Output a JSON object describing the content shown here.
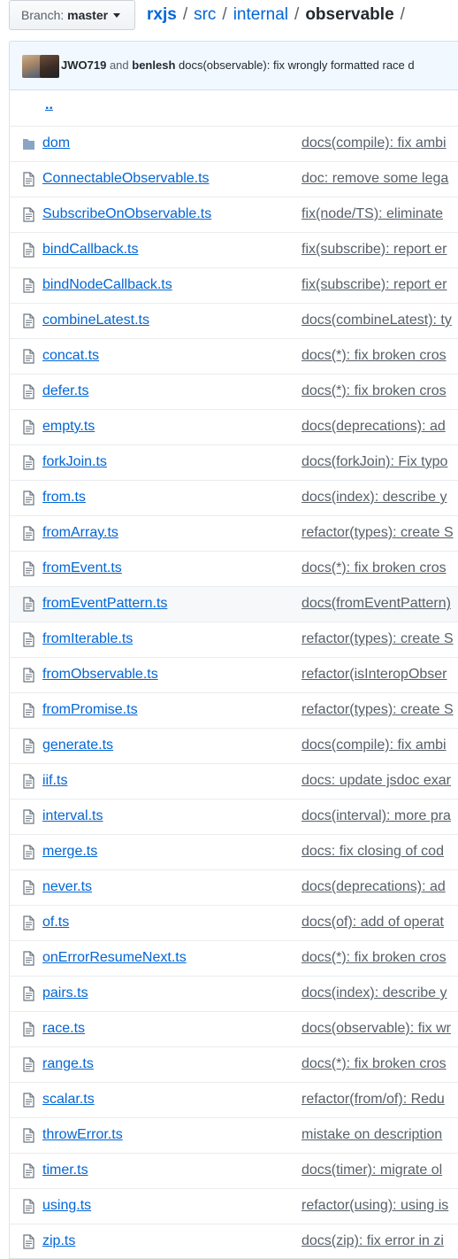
{
  "branch": {
    "label": "Branch:",
    "value": "master"
  },
  "breadcrumb": {
    "root": "rxjs",
    "parts": [
      "src",
      "internal"
    ],
    "current": "observable",
    "trailing_sep": "/"
  },
  "commit": {
    "author1": "JWO719",
    "and": "and",
    "author2": "benlesh",
    "message": "docs(observable): fix wrongly formatted race d"
  },
  "parent_dir": "..",
  "files": [
    {
      "name": "dom",
      "type": "folder",
      "message": "docs(compile): fix ambi"
    },
    {
      "name": "ConnectableObservable.ts",
      "type": "file",
      "message": "doc: remove some lega"
    },
    {
      "name": "SubscribeOnObservable.ts",
      "type": "file",
      "message": "fix(node/TS): eliminate"
    },
    {
      "name": "bindCallback.ts",
      "type": "file",
      "message": "fix(subscribe): report er"
    },
    {
      "name": "bindNodeCallback.ts",
      "type": "file",
      "message": "fix(subscribe): report er"
    },
    {
      "name": "combineLatest.ts",
      "type": "file",
      "message": "docs(combineLatest): ty"
    },
    {
      "name": "concat.ts",
      "type": "file",
      "message": "docs(*): fix broken cros"
    },
    {
      "name": "defer.ts",
      "type": "file",
      "message": "docs(*): fix broken cros"
    },
    {
      "name": "empty.ts",
      "type": "file",
      "message": "docs(deprecations): ad"
    },
    {
      "name": "forkJoin.ts",
      "type": "file",
      "message": "docs(forkJoin): Fix typo"
    },
    {
      "name": "from.ts",
      "type": "file",
      "message": "docs(index): describe y"
    },
    {
      "name": "fromArray.ts",
      "type": "file",
      "message": "refactor(types): create S"
    },
    {
      "name": "fromEvent.ts",
      "type": "file",
      "message": "docs(*): fix broken cros"
    },
    {
      "name": "fromEventPattern.ts",
      "type": "file",
      "message": "docs(fromEventPattern)",
      "highlighted": true
    },
    {
      "name": "fromIterable.ts",
      "type": "file",
      "message": "refactor(types): create S"
    },
    {
      "name": "fromObservable.ts",
      "type": "file",
      "message": "refactor(isInteropObser"
    },
    {
      "name": "fromPromise.ts",
      "type": "file",
      "message": "refactor(types): create S"
    },
    {
      "name": "generate.ts",
      "type": "file",
      "message": "docs(compile): fix ambi"
    },
    {
      "name": "iif.ts",
      "type": "file",
      "message": "docs: update jsdoc exar"
    },
    {
      "name": "interval.ts",
      "type": "file",
      "message": "docs(interval): more pra"
    },
    {
      "name": "merge.ts",
      "type": "file",
      "message": "docs: fix closing of cod"
    },
    {
      "name": "never.ts",
      "type": "file",
      "message": "docs(deprecations): ad"
    },
    {
      "name": "of.ts",
      "type": "file",
      "message": "docs(of): add of operat"
    },
    {
      "name": "onErrorResumeNext.ts",
      "type": "file",
      "message": "docs(*): fix broken cros"
    },
    {
      "name": "pairs.ts",
      "type": "file",
      "message": "docs(index): describe y"
    },
    {
      "name": "race.ts",
      "type": "file",
      "message": "docs(observable): fix wr"
    },
    {
      "name": "range.ts",
      "type": "file",
      "message": "docs(*): fix broken cros"
    },
    {
      "name": "scalar.ts",
      "type": "file",
      "message": "refactor(from/of): Redu"
    },
    {
      "name": "throwError.ts",
      "type": "file",
      "message": "mistake on description"
    },
    {
      "name": "timer.ts",
      "type": "file",
      "message": "docs(timer): migrate ol"
    },
    {
      "name": "using.ts",
      "type": "file",
      "message": "refactor(using): using is"
    },
    {
      "name": "zip.ts",
      "type": "file",
      "message": "docs(zip): fix error in zi"
    }
  ],
  "colors": {
    "link": "#0366d6",
    "muted": "#586069",
    "commit_bg": "#f1f8ff",
    "icon": "#6a737d"
  }
}
